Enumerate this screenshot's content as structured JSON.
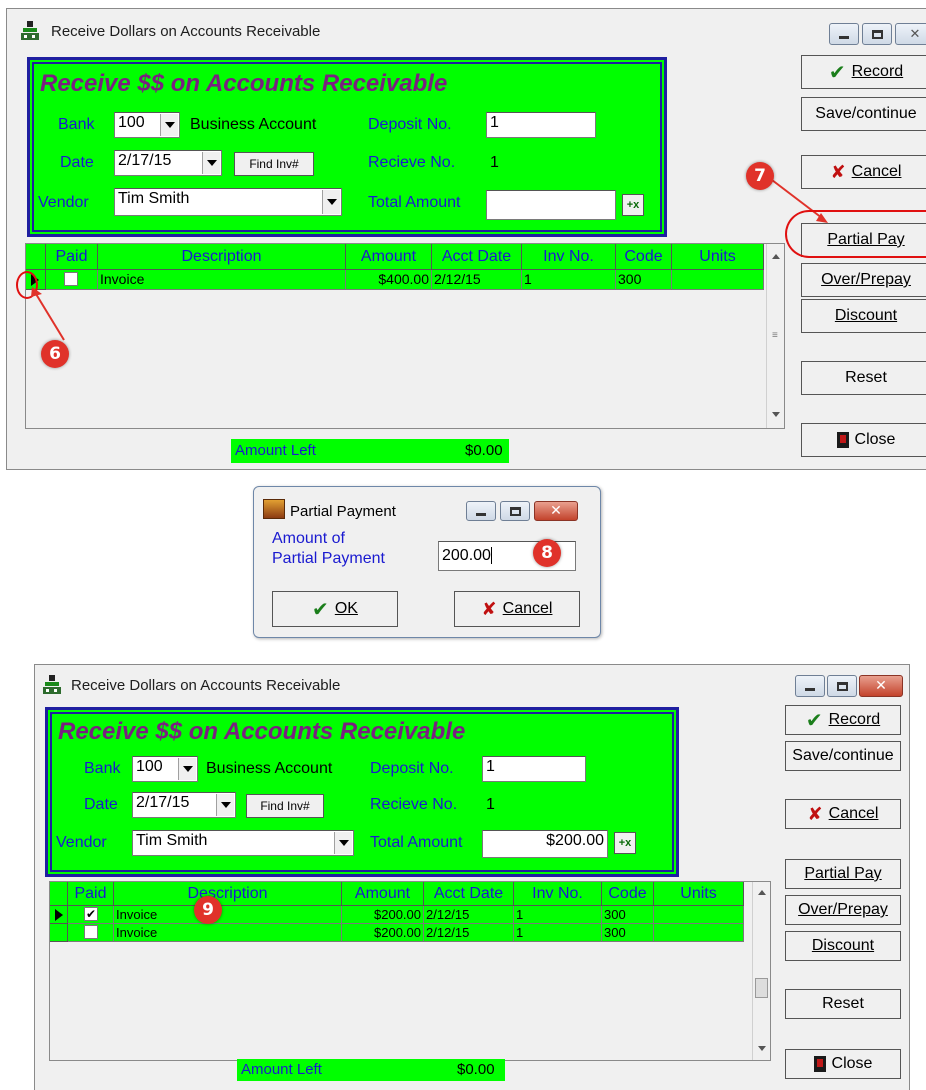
{
  "window": {
    "title": "Receive Dollars on Accounts Receivable",
    "heading": "Receive $$ on Accounts Receivable",
    "bank_label": "Bank",
    "bank_value": "100",
    "bank_name": "Business Account",
    "date_label": "Date",
    "date_value": "2/17/15",
    "find_inv_label": "Find Inv#",
    "vendor_label": "Vendor",
    "vendor_value": "Tim Smith",
    "deposit_label": "Deposit No.",
    "deposit_value": "1",
    "receive_label": "Recieve No.",
    "receive_value": "1",
    "total_label": "Total Amount",
    "calc_icon": "calculator-icon"
  },
  "grid": {
    "columns": [
      "Paid",
      "Description",
      "Amount",
      "Acct Date",
      "Inv No.",
      "Code",
      "Units"
    ]
  },
  "before": {
    "rows": [
      {
        "description": "Invoice",
        "amount": "$400.00",
        "acct_date": "2/12/15",
        "inv_no": "1",
        "code": "300",
        "paid": false
      }
    ],
    "total_amount": "",
    "amount_left_label": "Amount Left",
    "amount_left_value": "$0.00"
  },
  "after": {
    "rows": [
      {
        "description": "Invoice",
        "amount": "$200.00",
        "acct_date": "2/12/15",
        "inv_no": "1",
        "code": "300",
        "paid": true
      },
      {
        "description": "Invoice",
        "amount": "$200.00",
        "acct_date": "2/12/15",
        "inv_no": "1",
        "code": "300",
        "paid": false
      }
    ],
    "total_amount": "$200.00",
    "amount_left_label": "Amount Left",
    "amount_left_value": "$0.00"
  },
  "buttons": {
    "record": "Record",
    "save_continue": "Save/continue",
    "cancel": "Cancel",
    "partial_pay": "Partial Pay",
    "over_prepay": "Over/Prepay",
    "discount": "Discount",
    "reset": "Reset",
    "close": "Close"
  },
  "dialog": {
    "title": "Partial Payment",
    "label_line1": "Amount of",
    "label_line2": "Partial Payment",
    "amount_value": "200.00",
    "ok": "OK",
    "cancel": "Cancel"
  },
  "callouts": {
    "step6": "6",
    "step7": "7",
    "step8": "8",
    "step9": "9"
  },
  "colors": {
    "form_green": "#00ff00",
    "label_blue": "#1a1ad0",
    "title_purple": "#7a2080",
    "callout_red": "#e0322a"
  }
}
